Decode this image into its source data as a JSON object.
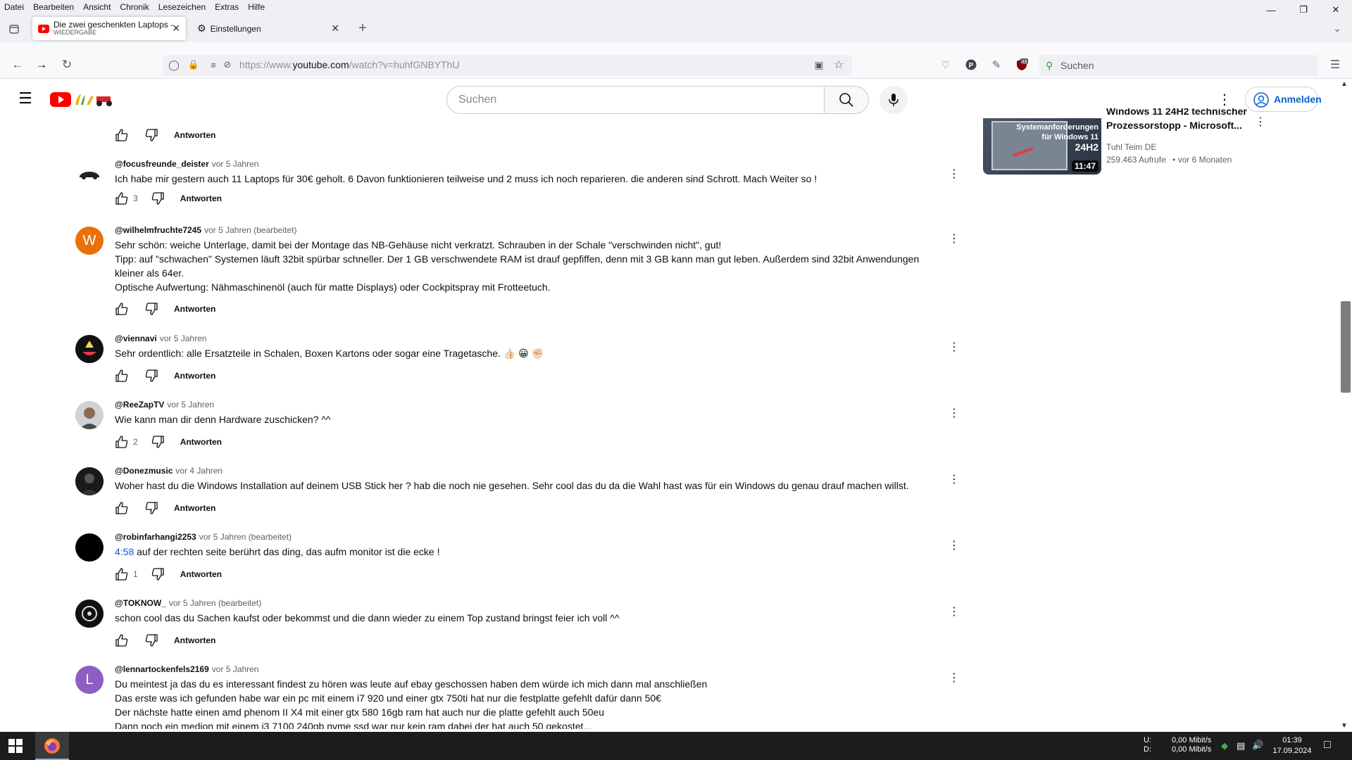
{
  "menubar": {
    "items": [
      "Datei",
      "Bearbeiten",
      "Ansicht",
      "Chronik",
      "Lesezeichen",
      "Extras",
      "Hilfe"
    ]
  },
  "tabs": {
    "active_title": "Die zwei geschenkten Laptops -",
    "active_subtitle": "WIEDERGABE",
    "second_title": "Einstellungen",
    "new_tab": "+"
  },
  "navbar": {
    "url_prefix": "https://www.",
    "url_host": "youtube.com",
    "url_path": "/watch?v=huhfGNBYThU",
    "search_placeholder": "Suchen",
    "ext_badge": "43"
  },
  "youtube": {
    "search_placeholder": "Suchen",
    "signin_label": "Anmelden"
  },
  "sidebar_video": {
    "title_partial": "Windows 11 24H2 technischer",
    "title_line2": "Prozessorstopp - Microsoft...",
    "channel": "Tuhl Teim DE",
    "views": "259.463 Aufrufe",
    "age": "• vor 6 Monaten",
    "thumb_text_1": "Systemanforderungen",
    "thumb_text_2": "für Windows 11",
    "thumb_text_3": "24H2",
    "duration": "11:47"
  },
  "reply_label": "Antworten",
  "comments": [
    {
      "author": "@focusfreunde_deister",
      "time": "vor 5 Jahren",
      "lines": [
        "Ich habe mir gestern auch 11 Laptops für 30€ geholt. 6 Davon funktionieren teilweise und 2 muss ich noch reparieren. die anderen sind Schrott. Mach Weiter so !"
      ],
      "likes": "3"
    },
    {
      "author": "@wilhelmfruchte7245",
      "time": "vor 5 Jahren (bearbeitet)",
      "avatar_letter": "W",
      "lines": [
        "Sehr schön: weiche Unterlage, damit bei der Montage das NB-Gehäuse nicht verkratzt. Schrauben in der Schale \"verschwinden nicht\", gut!",
        "Tipp: auf \"schwachen\" Systemen läuft 32bit spürbar schneller. Der 1 GB verschwendete RAM ist drauf gepfiffen, denn mit 3 GB kann man gut leben. Außerdem sind 32bit Anwendungen",
        "kleiner als 64er.",
        "Optische Aufwertung: Nähmaschinenöl (auch für matte Displays) oder Cockpitspray mit Frotteetuch."
      ],
      "likes": ""
    },
    {
      "author": "@viennavi",
      "time": "vor 5 Jahren",
      "lines": [
        "Sehr ordentlich: alle Ersatzteile in Schalen, Boxen Kartons oder sogar eine Tragetasche. 👍🏻 😀 ✊🏻"
      ],
      "likes": ""
    },
    {
      "author": "@ReeZapTV",
      "time": "vor 5 Jahren",
      "lines": [
        "Wie kann man dir denn Hardware zuschicken? ^^"
      ],
      "likes": "2"
    },
    {
      "author": "@Donezmusic",
      "time": "vor 4 Jahren",
      "lines": [
        "Woher hast du die Windows Installation auf deinem USB Stick her ? hab die noch nie gesehen. Sehr cool das du da die Wahl hast was für ein Windows du genau drauf machen willst."
      ],
      "likes": ""
    },
    {
      "author": "@robinfarhangi2253",
      "time": "vor 5 Jahren (bearbeitet)",
      "timestamp_link": "4:58",
      "lines": [
        " auf der rechten seite berührt das ding, das aufm monitor ist die ecke !"
      ],
      "likes": "1"
    },
    {
      "author": "@TOKNOW_",
      "time": "vor 5 Jahren (bearbeitet)",
      "lines": [
        "schon cool das du Sachen kaufst oder bekommst und die dann wieder zu einem Top zustand bringst feier ich voll ^^"
      ],
      "likes": ""
    },
    {
      "author": "@lennartockenfels2169",
      "time": "vor 5 Jahren",
      "avatar_letter": "L",
      "lines": [
        "Du meintest ja das du es interessant findest zu hören was leute auf ebay geschossen haben dem würde ich mich dann mal anschließen",
        "Das erste was ich gefunden habe war ein pc mit einem i7 920 und einer gtx 750ti hat nur die festplatte gefehlt dafür dann 50€",
        "Der nächste hatte einen amd phenom II X4 mit einer gtx 580 16gb ram hat auch nur die platte gefehlt auch 50eu",
        "Dann noch ein medion mit einem i3 7100 240gb nvme ssd war nur kein ram dabei der hat auch 50 gekostet..."
      ],
      "likes": ""
    }
  ],
  "taskbar": {
    "net_up_label": "U:",
    "net_down_label": "D:",
    "net_up": "0,00 Mibit/s",
    "net_down": "0,00 Mibit/s",
    "time": "01:39",
    "date": "17.09.2024"
  },
  "colors": {
    "accent_blue": "#065fd4",
    "avatar_w": "#e8710a",
    "avatar_l": "#8e5ec4"
  }
}
